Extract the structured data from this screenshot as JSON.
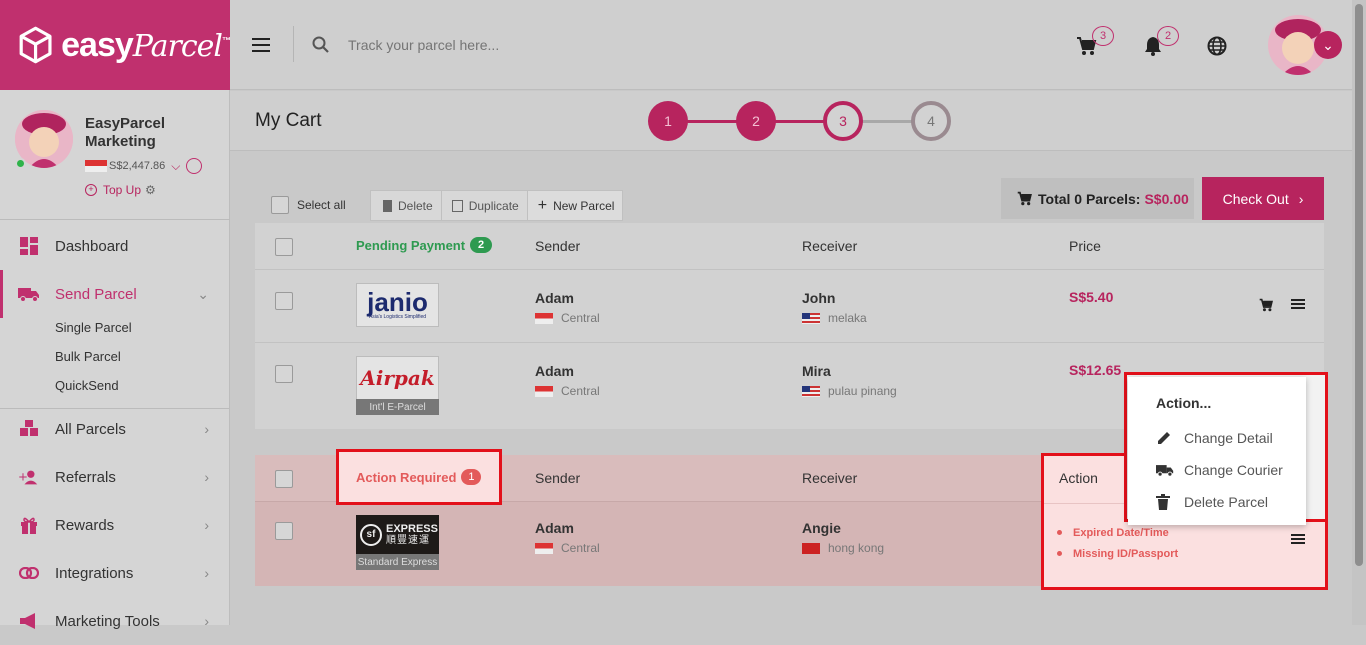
{
  "brand": {
    "name": "easy",
    "name2": "Parcel",
    "tm": "™"
  },
  "topbar": {
    "search_placeholder": "Track your parcel here...",
    "cart_count": "3",
    "notif_count": "2"
  },
  "profile": {
    "name": "EasyParcel Marketing",
    "balance": "S$2,447.86",
    "topup": "Top Up"
  },
  "sidebar": {
    "items": [
      {
        "label": "Dashboard"
      },
      {
        "label": "Send Parcel"
      },
      {
        "label": "All Parcels"
      },
      {
        "label": "Referrals"
      },
      {
        "label": "Rewards"
      },
      {
        "label": "Integrations"
      },
      {
        "label": "Marketing Tools"
      }
    ],
    "sub_items": [
      "Single Parcel",
      "Bulk Parcel",
      "QuickSend"
    ]
  },
  "cart": {
    "title": "My Cart",
    "steps": [
      "1",
      "2",
      "3",
      "4"
    ],
    "select_all": "Select all",
    "delete": "Delete",
    "duplicate": "Duplicate",
    "new_parcel": "New Parcel",
    "total_label": "Total 0 Parcels:",
    "total_value": "S$0.00",
    "checkout": "Check Out"
  },
  "pending": {
    "label": "Pending Payment",
    "count": "2",
    "col_sender": "Sender",
    "col_receiver": "Receiver",
    "col_price": "Price",
    "rows": [
      {
        "courier": "janio",
        "courier_sub": "Asia's Logistics Simplified",
        "sender": "Adam",
        "sender_region": "Central",
        "receiver": "John",
        "receiver_region": "melaka",
        "price": "S$5.40",
        "tag": ""
      },
      {
        "courier": "Airpak",
        "courier_sub": "",
        "sender": "Adam",
        "sender_region": "Central",
        "receiver": "Mira",
        "receiver_region": "pulau pinang",
        "price": "S$12.65",
        "tag": "Int'l E-Parcel"
      }
    ]
  },
  "action_required": {
    "label": "Action Required",
    "count": "1",
    "col_sender": "Sender",
    "col_receiver": "Receiver",
    "col_action": "Action",
    "rows": [
      {
        "courier": "EXPRESS",
        "courier_cn": "順豐速運",
        "sender": "Adam",
        "sender_region": "Central",
        "receiver": "Angie",
        "receiver_region": "hong kong",
        "tag": "Standard Express",
        "issues": [
          "Expired Date/Time",
          "Missing ID/Passport"
        ]
      }
    ]
  },
  "action_menu": {
    "title": "Action...",
    "items": [
      {
        "label": "Change Detail",
        "icon": "pencil-icon"
      },
      {
        "label": "Change Courier",
        "icon": "truck-icon"
      },
      {
        "label": "Delete Parcel",
        "icon": "trash-icon"
      }
    ]
  },
  "colors": {
    "brand": "#c0306e",
    "accent": "#b7245e",
    "pending": "#2e9a50",
    "alert": "#e35a5a",
    "frame": "#e3101a"
  }
}
